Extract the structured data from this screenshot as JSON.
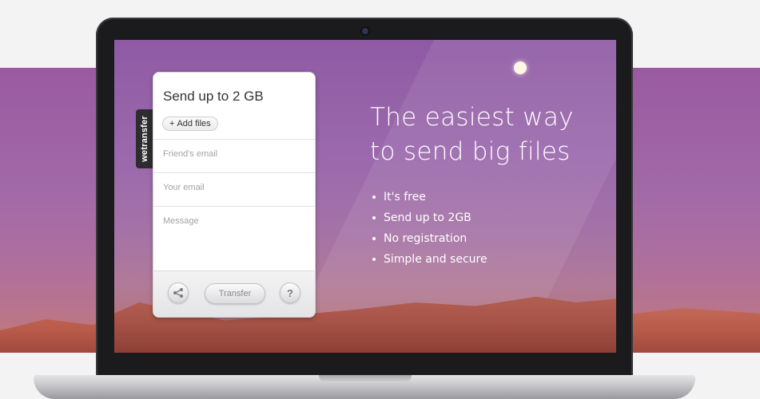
{
  "brand": {
    "name": "wetransfer"
  },
  "widget": {
    "title": "Send up to 2 GB",
    "add_files_label": "Add files",
    "add_icon": "+",
    "friend_email_placeholder": "Friend's email",
    "your_email_placeholder": "Your email",
    "message_placeholder": "Message",
    "transfer_label": "Transfer",
    "share_icon": "share-icon",
    "help_label": "?"
  },
  "hero": {
    "title_line1": "The easiest way",
    "title_line2": "to send big files",
    "features": [
      "It's free",
      "Send up to 2GB",
      "No registration",
      "Simple and secure"
    ]
  },
  "colors": {
    "sky_top": "#8f5aa4",
    "desert": "#b85a4a",
    "brand_tab": "#2d2d2f"
  }
}
